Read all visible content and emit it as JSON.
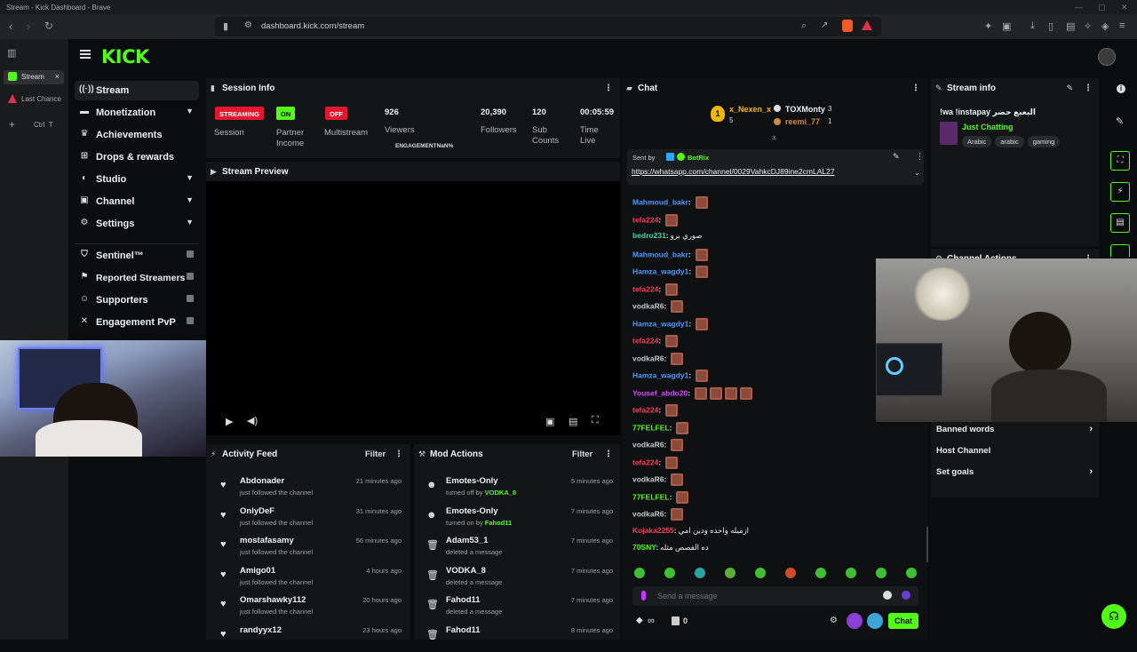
{
  "window": {
    "title": "Stream - Kick Dashboard - Brave"
  },
  "browser": {
    "url": "dashboard.kick.com/stream"
  },
  "tabs": [
    {
      "label": "Stream",
      "close": "×"
    },
    {
      "label": "Last Chance"
    }
  ],
  "shortcut": {
    "keys": "Ctrl  T"
  },
  "brand": {
    "logo": "KICK",
    "color": "#53fc18"
  },
  "sidebar": {
    "items": [
      {
        "label": "Stream",
        "icon": "wifi-icon"
      },
      {
        "label": "Monetization",
        "icon": "dollar-icon"
      },
      {
        "label": "Achievements",
        "icon": "trophy-icon"
      },
      {
        "label": "Drops & rewards",
        "icon": "gift-icon"
      },
      {
        "label": "Studio",
        "icon": "palette-icon"
      },
      {
        "label": "Channel",
        "icon": "channel-icon"
      },
      {
        "label": "Settings",
        "icon": "gear-icon"
      },
      {
        "label": "Sentinel™",
        "icon": "shield-icon"
      },
      {
        "label": "Reported Streamers",
        "icon": "flag-icon"
      },
      {
        "label": "Supporters",
        "icon": "users-icon"
      },
      {
        "label": "Engagement PvP",
        "icon": "swords-icon"
      }
    ]
  },
  "session": {
    "title": "Session Info",
    "streaming_badge": "STREAMING",
    "session_label": "Session",
    "partner_badge": "ON",
    "partner_label": "Partner Income",
    "multistream_badge": "OFF",
    "multistream_label": "Multistream",
    "viewers_value": "926",
    "viewers_label": "Viewers",
    "engagement_label": "ENGAGEMENT",
    "engagement_value": "NaN%",
    "followers_value": "20,390",
    "followers_label": "Followers",
    "subs_value": "120",
    "subs_label": "Sub Counts",
    "time_value": "00:05:59",
    "time_label": "Time Live"
  },
  "preview": {
    "title": "Stream Preview"
  },
  "activity": {
    "title": "Activity Feed",
    "filter": "Filter",
    "rows": [
      {
        "name": "Abdonader",
        "sub": "just followed the channel",
        "time": "21 minutes ago"
      },
      {
        "name": "OnlyDeF",
        "sub": "just followed the channel",
        "time": "31 minutes ago"
      },
      {
        "name": "mostafasamy",
        "sub": "just followed the channel",
        "time": "56 minutes ago"
      },
      {
        "name": "Amigo01",
        "sub": "just followed the channel",
        "time": "4 hours ago"
      },
      {
        "name": "Omarshawky112",
        "sub": "just followed the channel",
        "time": "20 hours ago"
      },
      {
        "name": "randyyx12",
        "sub": "",
        "time": "23 hours ago"
      }
    ]
  },
  "mod": {
    "title": "Mod Actions",
    "filter": "Filter",
    "rows": [
      {
        "name": "Emotes-Only",
        "sub": "turned off by",
        "actor": "VODKA_8",
        "time": "5 minutes ago"
      },
      {
        "name": "Emotes-Only",
        "sub": "turned on by",
        "actor": "Fahod11",
        "time": "7 minutes ago"
      },
      {
        "name": "Adam53_1",
        "sub": "deleted a message",
        "actor": "",
        "time": "7 minutes ago"
      },
      {
        "name": "VODKA_8",
        "sub": "deleted a message",
        "actor": "",
        "time": "7 minutes ago"
      },
      {
        "name": "Fahod11",
        "sub": "deleted a message",
        "actor": "",
        "time": "7 minutes ago"
      },
      {
        "name": "Fahod11",
        "sub": "",
        "actor": "",
        "time": "8 minutes ago"
      }
    ]
  },
  "chat": {
    "title": "Chat",
    "top_gifters": [
      {
        "name": "x_Nexen_x",
        "count": "5"
      },
      {
        "name": "TOXMonty",
        "count": "3"
      },
      {
        "name": "reemi_77",
        "count": "1"
      }
    ],
    "pinned": {
      "sent_by_label": "Sent by",
      "sender": "BotRix",
      "link": "https://whatsapp.com/channel/0029VahkcDJ89ine2cmLAL27"
    },
    "messages": [
      {
        "user": "Mahmoud_bakr",
        "color": "#4a9bff",
        "text": "",
        "emotes": 1
      },
      {
        "user": "tefa224",
        "color": "#ff3b5c",
        "text": "",
        "emotes": 1
      },
      {
        "user": "bedro231",
        "color": "#3fd9a8",
        "text": "صوري برو",
        "emotes": 0
      },
      {
        "user": "Mahmoud_bakr",
        "color": "#4a9bff",
        "text": "",
        "emotes": 1
      },
      {
        "user": "Hamza_wagdy1",
        "color": "#4a9bff",
        "text": "",
        "emotes": 1
      },
      {
        "user": "tefa224",
        "color": "#ff3b5c",
        "text": "",
        "emotes": 1
      },
      {
        "user": "vodkaR6",
        "color": "#c7c7c7",
        "text": "",
        "emotes": 1
      },
      {
        "user": "Hamza_wagdy1",
        "color": "#4a9bff",
        "text": "",
        "emotes": 1
      },
      {
        "user": "tefa224",
        "color": "#ff3b5c",
        "text": "",
        "emotes": 1
      },
      {
        "user": "vodkaR6",
        "color": "#c7c7c7",
        "text": "",
        "emotes": 1
      },
      {
        "user": "Hamza_wagdy1",
        "color": "#4a9bff",
        "text": "",
        "emotes": 1
      },
      {
        "user": "Yousef_abdo20",
        "color": "#d64bff",
        "text": "",
        "emotes": 4
      },
      {
        "user": "tefa224",
        "color": "#ff3b5c",
        "text": "",
        "emotes": 1
      },
      {
        "user": "77FELFEL",
        "color": "#53fc18",
        "text": "",
        "emotes": 1
      },
      {
        "user": "vodkaR6",
        "color": "#c7c7c7",
        "text": "",
        "emotes": 1
      },
      {
        "user": "tefa224",
        "color": "#ff3b5c",
        "text": "",
        "emotes": 1
      },
      {
        "user": "vodkaR6",
        "color": "#c7c7c7",
        "text": "",
        "emotes": 1
      },
      {
        "user": "77FELFEL",
        "color": "#53fc18",
        "text": "",
        "emotes": 1
      },
      {
        "user": "vodkaR6",
        "color": "#c7c7c7",
        "text": "",
        "emotes": 1
      },
      {
        "user": "Kojaka2255",
        "color": "#ff3b5c",
        "text": "ازميله واحده ودين امي",
        "emotes": 0
      },
      {
        "user": "70SNY",
        "color": "#53fc18",
        "text": "ده الفصص مثله",
        "emotes": 0
      }
    ],
    "input_placeholder": "Send a message",
    "points": "∞",
    "count": "0",
    "chat_button": "Chat"
  },
  "stream_info": {
    "title": "Stream info",
    "stream_title": "!wa !instapay البعبع حضر",
    "category": "Just Chatting",
    "tags": [
      "Arabic",
      "arabic",
      "gaming"
    ]
  },
  "channel_actions": {
    "title": "Channel Actions",
    "items": [
      {
        "label": "Banned words"
      },
      {
        "label": "Host Channel"
      },
      {
        "label": "Set goals"
      }
    ]
  }
}
